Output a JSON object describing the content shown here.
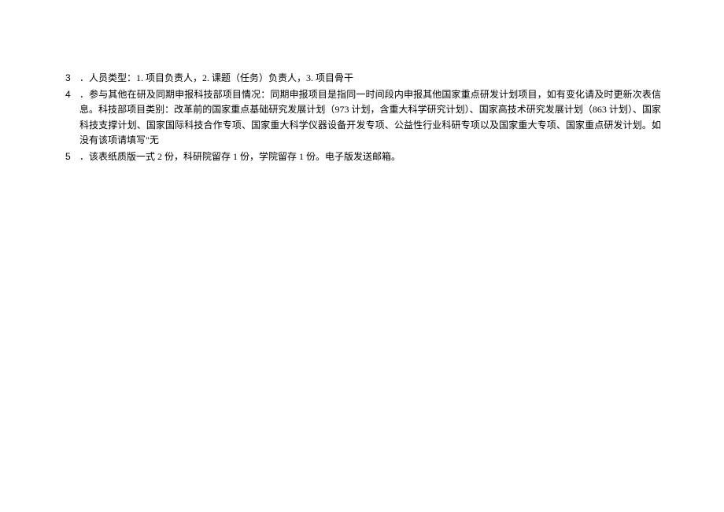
{
  "items": [
    {
      "number": "3",
      "text": "．人员类型：1. 项目负责人，2. 课题（任务）负责人，3. 项目骨干"
    },
    {
      "number": "4",
      "text": "．参与其他在研及同期申报科技部项目情况：同期申报项目是指同一时间段内申报其他国家重点研发计划项目，如有变化请及时更新次表信息。科技部项目类别：改革前的国家重点基础研究发展计划（973 计划，含重大科学研究计划）、国家高技术研究发展计划（863 计划）、国家科技支撑计划、国家国际科技合作专项、国家重大科学仪器设备开发专项、公益性行业科研专项以及国家重大专项、国家重点研发计划。如没有该项请填写\"无"
    },
    {
      "number": "5",
      "text": "．该表纸质版一式 2 份，科研院留存 1 份，学院留存 1 份。电子版发送邮箱。"
    }
  ]
}
